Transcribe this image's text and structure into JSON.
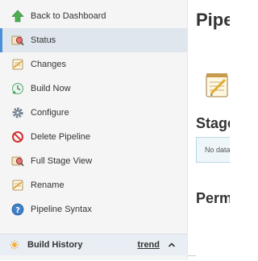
{
  "sidebar": {
    "items": [
      {
        "label": "Back to Dashboard",
        "icon": "up-arrow-icon"
      },
      {
        "label": "Status",
        "icon": "search-status-icon",
        "active": true
      },
      {
        "label": "Changes",
        "icon": "notepad-icon"
      },
      {
        "label": "Build Now",
        "icon": "clock-play-icon"
      },
      {
        "label": "Configure",
        "icon": "gear-icon"
      },
      {
        "label": "Delete Pipeline",
        "icon": "no-entry-icon"
      },
      {
        "label": "Full Stage View",
        "icon": "search-status-icon"
      },
      {
        "label": "Rename",
        "icon": "notepad-pencil-icon"
      },
      {
        "label": "Pipeline Syntax",
        "icon": "help-icon"
      }
    ]
  },
  "build_history": {
    "title": "Build History",
    "trend_label": "trend",
    "icon": "sun-icon",
    "toggle_icon": "chevron-up-icon"
  },
  "main": {
    "title": "Pipe",
    "stage_title": "Stage",
    "no_data": "No data",
    "permalinks_title": "Perm"
  },
  "colors": {
    "sidebar_bg": "#f5f5f5",
    "active_bg": "#dfe6ee",
    "active_marker": "#4a90d9",
    "build_history_bg": "#e8eef4",
    "no_data_border": "#b8d8e6"
  }
}
